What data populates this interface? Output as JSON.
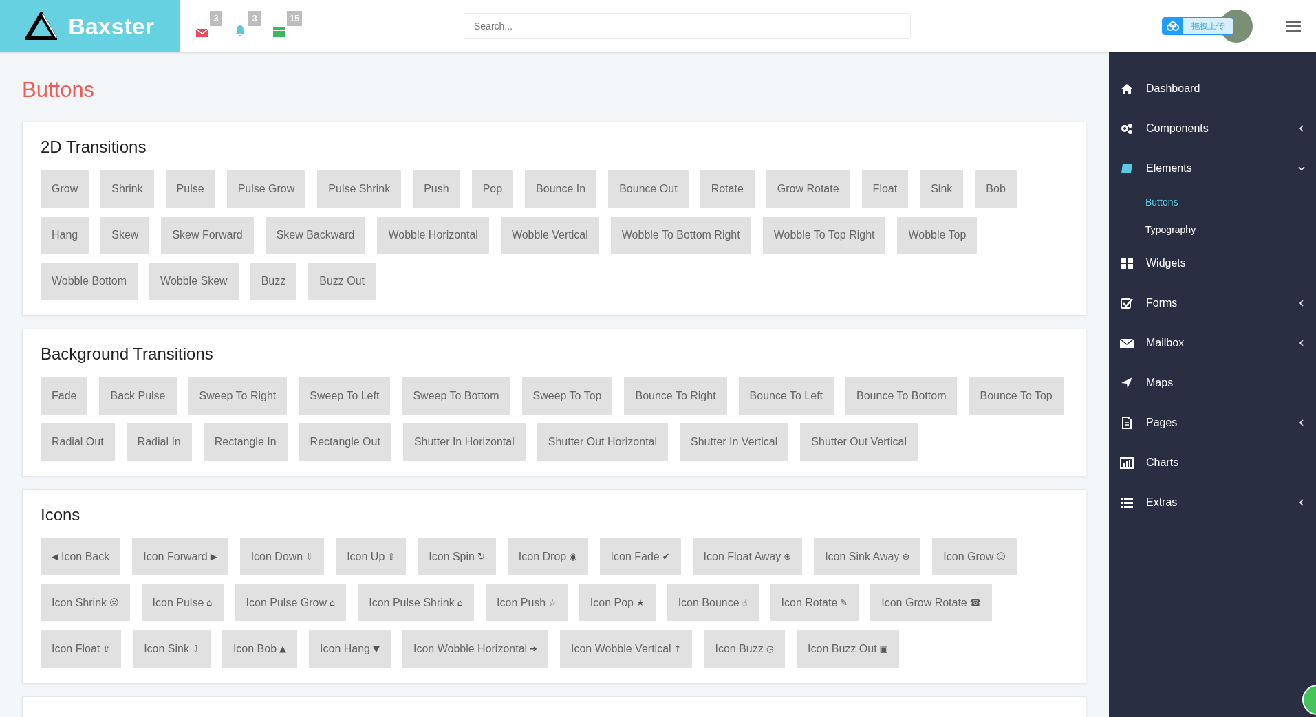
{
  "header": {
    "brand": "Baxster",
    "notifications": [
      {
        "count": "3"
      },
      {
        "count": "3"
      },
      {
        "count": "15"
      }
    ],
    "search": {
      "placeholder": "Search..."
    },
    "upload_widget": {
      "label": "拖拽上传"
    }
  },
  "page_title": "Buttons",
  "sections": [
    {
      "title": "2D Transitions",
      "buttons": [
        {
          "label": "Grow"
        },
        {
          "label": "Shrink"
        },
        {
          "label": "Pulse"
        },
        {
          "label": "Pulse Grow"
        },
        {
          "label": "Pulse Shrink"
        },
        {
          "label": "Push"
        },
        {
          "label": "Pop"
        },
        {
          "label": "Bounce In"
        },
        {
          "label": "Bounce Out"
        },
        {
          "label": "Rotate"
        },
        {
          "label": "Grow Rotate"
        },
        {
          "label": "Float"
        },
        {
          "label": "Sink"
        },
        {
          "label": "Bob"
        },
        {
          "label": "Hang"
        },
        {
          "label": "Skew"
        },
        {
          "label": "Skew Forward"
        },
        {
          "label": "Skew Backward"
        },
        {
          "label": "Wobble Horizontal"
        },
        {
          "label": "Wobble Vertical"
        },
        {
          "label": "Wobble To Bottom Right"
        },
        {
          "label": "Wobble To Top Right"
        },
        {
          "label": "Wobble Top"
        },
        {
          "label": "Wobble Bottom"
        },
        {
          "label": "Wobble Skew"
        },
        {
          "label": "Buzz"
        },
        {
          "label": "Buzz Out"
        }
      ]
    },
    {
      "title": "Background Transitions",
      "buttons": [
        {
          "label": "Fade"
        },
        {
          "label": "Back Pulse"
        },
        {
          "label": "Sweep To Right"
        },
        {
          "label": "Sweep To Left"
        },
        {
          "label": "Sweep To Bottom"
        },
        {
          "label": "Sweep To Top"
        },
        {
          "label": "Bounce To Right"
        },
        {
          "label": "Bounce To Left"
        },
        {
          "label": "Bounce To Bottom"
        },
        {
          "label": "Bounce To Top"
        },
        {
          "label": "Radial Out"
        },
        {
          "label": "Radial In"
        },
        {
          "label": "Rectangle In"
        },
        {
          "label": "Rectangle Out"
        },
        {
          "label": "Shutter In Horizontal"
        },
        {
          "label": "Shutter Out Horizontal"
        },
        {
          "label": "Shutter In Vertical"
        },
        {
          "label": "Shutter Out Vertical"
        }
      ]
    },
    {
      "title": "Icons",
      "buttons": [
        {
          "label": "Icon Back",
          "icon_before": "◀"
        },
        {
          "label": "Icon Forward",
          "icon_after": "▶"
        },
        {
          "label": "Icon Down",
          "icon_after": "⇩"
        },
        {
          "label": "Icon Up",
          "icon_after": "⇧"
        },
        {
          "label": "Icon Spin",
          "icon_after": "↻"
        },
        {
          "label": "Icon Drop",
          "icon_after": "◉"
        },
        {
          "label": "Icon Fade",
          "icon_after": "✔"
        },
        {
          "label": "Icon Float Away",
          "icon_after": "⊕"
        },
        {
          "label": "Icon Sink Away",
          "icon_after": "⊖"
        },
        {
          "label": "Icon Grow",
          "icon_after": "☺"
        },
        {
          "label": "Icon Shrink",
          "icon_after": "☹"
        },
        {
          "label": "Icon Pulse",
          "icon_after": "⌂"
        },
        {
          "label": "Icon Pulse Grow",
          "icon_after": "⌂"
        },
        {
          "label": "Icon Pulse Shrink",
          "icon_after": "⌂"
        },
        {
          "label": "Icon Push",
          "icon_after": "☆"
        },
        {
          "label": "Icon Pop",
          "icon_after": "★"
        },
        {
          "label": "Icon Bounce",
          "icon_after": "☝"
        },
        {
          "label": "Icon Rotate",
          "icon_after": "✎"
        },
        {
          "label": "Icon Grow Rotate",
          "icon_after": "☎"
        },
        {
          "label": "Icon Float",
          "icon_after": "⇧"
        },
        {
          "label": "Icon Sink",
          "icon_after": "⇩"
        },
        {
          "label": "Icon Bob",
          "icon_after": "▲"
        },
        {
          "label": "Icon Hang",
          "icon_after": "▼"
        },
        {
          "label": "Icon Wobble Horizontal",
          "icon_after": "➔"
        },
        {
          "label": "Icon Wobble Vertical",
          "icon_after": "↑"
        },
        {
          "label": "Icon Buzz",
          "icon_after": "◷"
        },
        {
          "label": "Icon Buzz Out",
          "icon_after": "▣"
        }
      ]
    }
  ],
  "sidebar": {
    "items": [
      {
        "label": "Dashboard"
      },
      {
        "label": "Components",
        "expanded": false
      },
      {
        "label": "Elements",
        "expanded": true,
        "children": [
          {
            "label": "Buttons",
            "selected": true
          },
          {
            "label": "Typography",
            "selected": false
          }
        ]
      },
      {
        "label": "Widgets"
      },
      {
        "label": "Forms",
        "expanded": false
      },
      {
        "label": "Mailbox",
        "expanded": false
      },
      {
        "label": "Maps"
      },
      {
        "label": "Pages",
        "expanded": false
      },
      {
        "label": "Charts"
      },
      {
        "label": "Extras",
        "expanded": false
      }
    ]
  }
}
